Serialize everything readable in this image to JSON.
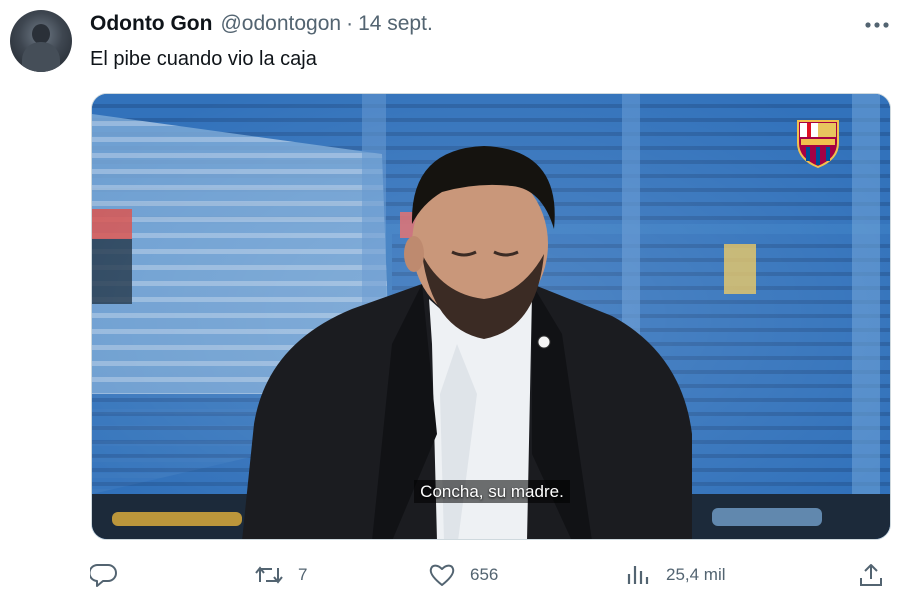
{
  "author": {
    "name": "Odonto Gon",
    "handle": "@odontogon",
    "separator": "·",
    "date": "14 sept."
  },
  "tweet": {
    "text": "El pibe cuando vio la caja"
  },
  "media": {
    "caption": "Concha, su madre.",
    "logo": "fc-barcelona-crest"
  },
  "actions": {
    "reply": {
      "icon": "reply-icon",
      "count": ""
    },
    "retweet": {
      "icon": "retweet-icon",
      "count": "7"
    },
    "like": {
      "icon": "heart-icon",
      "count": "656"
    },
    "views": {
      "icon": "views-icon",
      "count": "25,4 mil"
    },
    "share": {
      "icon": "share-icon",
      "count": ""
    }
  },
  "colors": {
    "text_primary": "#0f1419",
    "text_secondary": "#536471",
    "stadium_blue": "#2f6fb8"
  }
}
